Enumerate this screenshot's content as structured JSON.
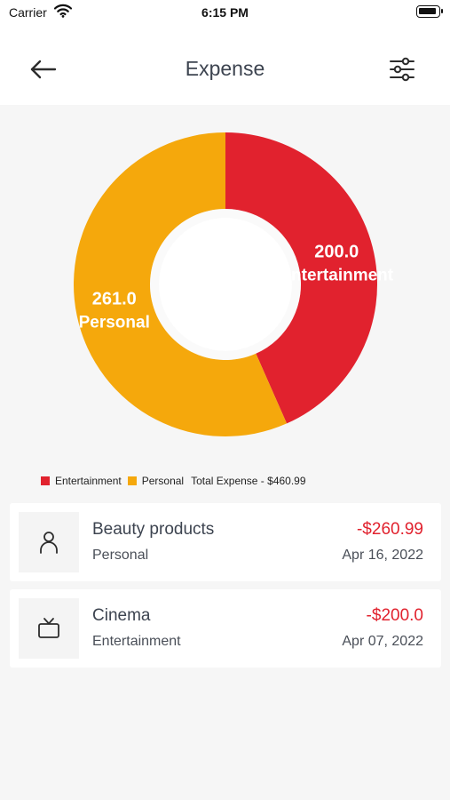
{
  "status_bar": {
    "carrier": "Carrier",
    "time": "6:15 PM"
  },
  "header": {
    "title": "Expense",
    "back_icon": "arrow-left-icon",
    "filter_icon": "sliders-icon"
  },
  "chart_data": {
    "type": "pie",
    "categories": [
      "Entertainment",
      "Personal"
    ],
    "values": [
      200.0,
      261.0
    ],
    "data_labels": [
      {
        "value": "200.0",
        "category": "Entertainment"
      },
      {
        "value": "261.0",
        "category": "Personal"
      }
    ],
    "colors": [
      "#e1222e",
      "#f5a80c"
    ],
    "donut": true,
    "legend": "bottom-left"
  },
  "legend": {
    "items": [
      {
        "label": "Entertainment",
        "color": "#e1222e"
      },
      {
        "label": "Personal",
        "color": "#f5a80c"
      }
    ],
    "total": "Total Expense - $460.99"
  },
  "transactions": [
    {
      "name": "Beauty products",
      "category": "Personal",
      "amount": "-$260.99",
      "date": "Apr 16, 2022",
      "icon": "person-icon"
    },
    {
      "name": "Cinema",
      "category": "Entertainment",
      "amount": "-$200.0",
      "date": "Apr 07, 2022",
      "icon": "tv-icon"
    }
  ],
  "colors": {
    "expense": "#e1222e",
    "entertainment": "#e1222e",
    "personal": "#f5a80c",
    "background": "#f6f6f6"
  }
}
